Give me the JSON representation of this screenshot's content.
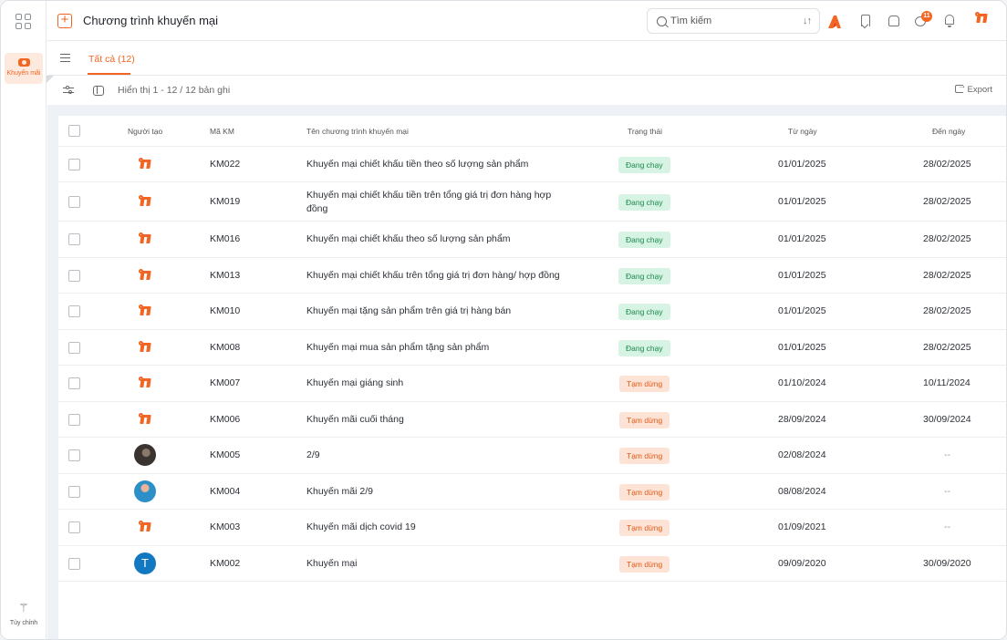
{
  "rail": {
    "active_label": "Khuyến mãi",
    "custom_label": "Tùy chỉnh"
  },
  "header": {
    "title": "Chương trình khuyến mại",
    "search_placeholder": "Tìm kiếm",
    "notification_count": "11"
  },
  "tabs": [
    {
      "label": "Tất cả (12)",
      "active": true
    }
  ],
  "toolbar": {
    "showing": "Hiển thị 1 - 12 / 12 bản ghi",
    "export_label": "Export"
  },
  "colors": {
    "accent": "#f26522",
    "running_bg": "#d7f3e3",
    "running_text": "#19894a",
    "paused_bg": "#fde3d6",
    "paused_text": "#e35a16"
  },
  "table": {
    "columns": [
      "Người tạo",
      "Mã KM",
      "Tên chương trình khuyến mại",
      "Trạng thái",
      "Từ ngày",
      "Đến ngày"
    ],
    "rows": [
      {
        "creator": "brand-logo",
        "code": "KM022",
        "name": "Khuyến mại chiết khấu tiền theo số lượng sản phẩm",
        "status": "Đang chạy",
        "status_type": "running",
        "from": "01/01/2025",
        "to": "28/02/2025"
      },
      {
        "creator": "brand-logo",
        "code": "KM019",
        "name": "Khuyến mại chiết khấu tiền trên tổng giá trị đơn hàng hợp đồng",
        "status": "Đang chạy",
        "status_type": "running",
        "from": "01/01/2025",
        "to": "28/02/2025"
      },
      {
        "creator": "brand-logo",
        "code": "KM016",
        "name": "Khuyến mại chiết khấu theo số lượng sản phẩm",
        "status": "Đang chạy",
        "status_type": "running",
        "from": "01/01/2025",
        "to": "28/02/2025"
      },
      {
        "creator": "brand-logo",
        "code": "KM013",
        "name": "Khuyến mại chiết khấu trên tổng giá trị đơn hàng/ hợp đồng",
        "status": "Đang chạy",
        "status_type": "running",
        "from": "01/01/2025",
        "to": "28/02/2025"
      },
      {
        "creator": "brand-logo",
        "code": "KM010",
        "name": "Khuyến mại tặng sản phẩm trên giá trị hàng bán",
        "status": "Đang chạy",
        "status_type": "running",
        "from": "01/01/2025",
        "to": "28/02/2025"
      },
      {
        "creator": "brand-logo",
        "code": "KM008",
        "name": "Khuyến mại mua sản phẩm tặng sản phẩm",
        "status": "Đang chạy",
        "status_type": "running",
        "from": "01/01/2025",
        "to": "28/02/2025"
      },
      {
        "creator": "brand-logo",
        "code": "KM007",
        "name": "Khuyến mại giáng sinh",
        "status": "Tạm dừng",
        "status_type": "paused",
        "from": "01/10/2024",
        "to": "10/11/2024"
      },
      {
        "creator": "brand-logo",
        "code": "KM006",
        "name": "Khuyến mãi cuối tháng",
        "status": "Tạm dừng",
        "status_type": "paused",
        "from": "28/09/2024",
        "to": "30/09/2024"
      },
      {
        "creator": "photo-1",
        "code": "KM005",
        "name": "2/9",
        "status": "Tạm dừng",
        "status_type": "paused",
        "from": "02/08/2024",
        "to": "--"
      },
      {
        "creator": "photo-2",
        "code": "KM004",
        "name": "Khuyến mãi 2/9",
        "status": "Tạm dừng",
        "status_type": "paused",
        "from": "08/08/2024",
        "to": "--"
      },
      {
        "creator": "brand-logo",
        "code": "KM003",
        "name": "Khuyến mãi dịch covid 19",
        "status": "Tạm dừng",
        "status_type": "paused",
        "from": "01/09/2021",
        "to": "--"
      },
      {
        "creator": "letter-T",
        "creator_letter": "T",
        "code": "KM002",
        "name": "Khuyến mại",
        "status": "Tạm dừng",
        "status_type": "paused",
        "from": "09/09/2020",
        "to": "30/09/2020"
      }
    ]
  }
}
